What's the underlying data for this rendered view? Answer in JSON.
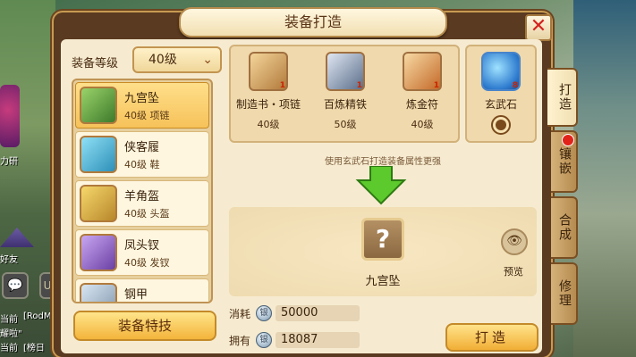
{
  "window": {
    "title": "装备打造"
  },
  "background": {
    "labels": [
      "力研",
      "好友",
      "当前",
      "[RodM",
      "当前",
      "耀啦\"",
      "当前",
      "[榜日"
    ],
    "chat_icon": "chat-bubble-icon"
  },
  "level": {
    "label": "装备等级",
    "value": "40级"
  },
  "items": [
    {
      "name": "九宫坠",
      "sub": "40级  项链",
      "icon": "pendant-icon"
    },
    {
      "name": "侠客履",
      "sub": "40级  鞋",
      "icon": "boots-icon"
    },
    {
      "name": "羊角盔",
      "sub": "40级  头盔",
      "icon": "helmet-icon"
    },
    {
      "name": "凤头钗",
      "sub": "40级  发钗",
      "icon": "hairpin-icon"
    },
    {
      "name": "钢甲",
      "sub": "",
      "icon": "armor-icon"
    }
  ],
  "special_button": "装备特技",
  "materials": [
    {
      "name": "制造书・项链",
      "level": "40级",
      "count": "1",
      "icon": "scroll-icon"
    },
    {
      "name": "百炼精铁",
      "level": "50级",
      "count": "1",
      "icon": "iron-icon"
    },
    {
      "name": "炼金符",
      "level": "40级",
      "count": "1",
      "icon": "charm-icon"
    }
  ],
  "stone": {
    "name": "玄武石",
    "count": "8",
    "icon": "stone-icon"
  },
  "hint": "使用玄武石打造装备属性更强",
  "result": {
    "name": "九宫坠",
    "placeholder": "?"
  },
  "preview_label": "预览",
  "cost": {
    "label": "消耗",
    "value": "50000"
  },
  "owned": {
    "label": "拥有",
    "value": "18087"
  },
  "forge_button": "打造",
  "tabs": [
    "打造",
    "镶嵌",
    "合成",
    "修理"
  ]
}
